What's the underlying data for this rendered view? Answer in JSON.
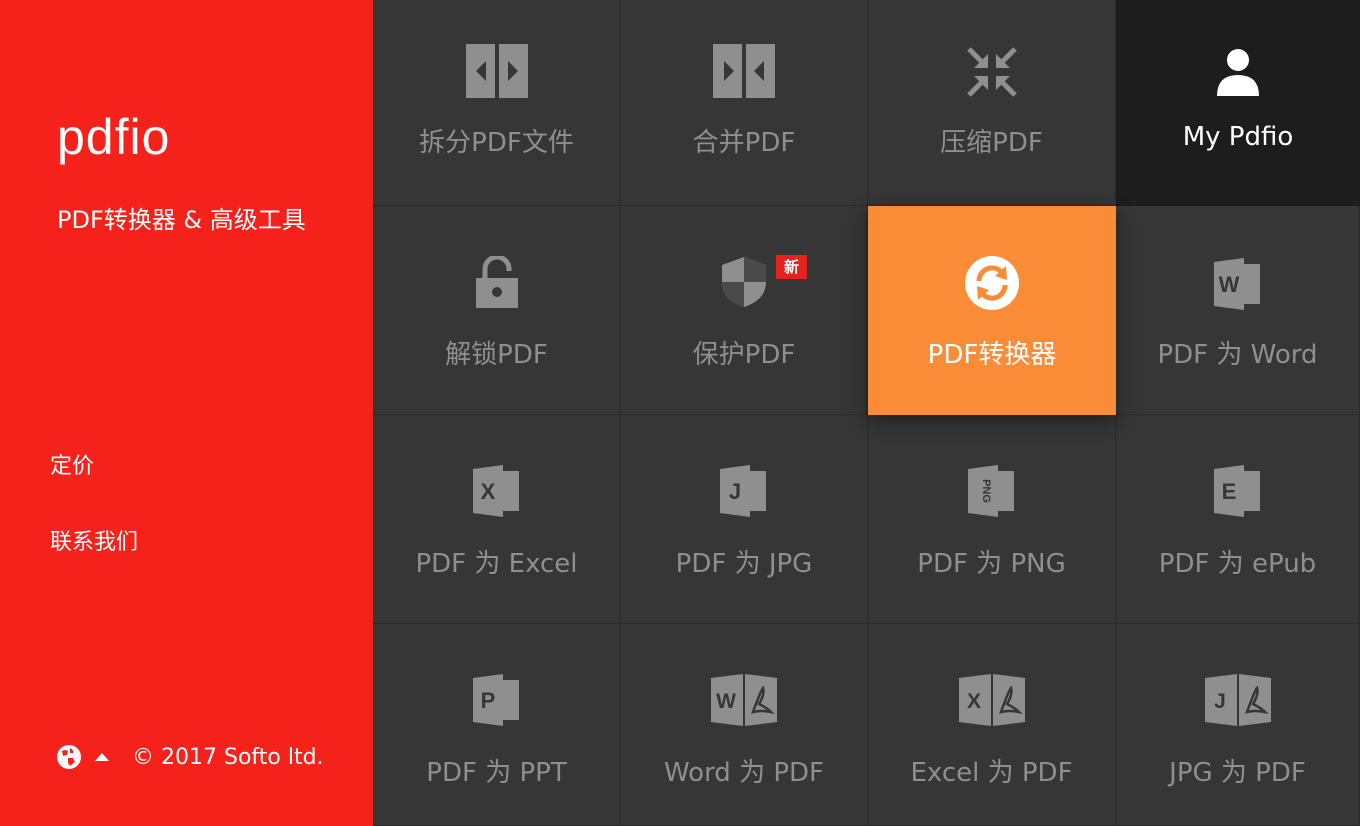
{
  "sidebar": {
    "logo": "pdfio",
    "tagline": "PDF转换器 & 高级工具",
    "nav": [
      {
        "label": "定价"
      },
      {
        "label": "联系我们"
      }
    ],
    "footer": {
      "copyright": "© 2017 Softo ltd."
    }
  },
  "tiles": [
    {
      "label": "拆分PDF文件",
      "icon": "split-icon"
    },
    {
      "label": "合并PDF",
      "icon": "merge-icon"
    },
    {
      "label": "压缩PDF",
      "icon": "compress-icon"
    },
    {
      "label": "My Pdfio",
      "icon": "user-icon"
    },
    {
      "label": "解锁PDF",
      "icon": "unlock-icon"
    },
    {
      "label": "保护PDF",
      "icon": "shield-icon",
      "badge": "新"
    },
    {
      "label": "PDF转换器",
      "icon": "convert-icon"
    },
    {
      "label": "PDF 为 Word",
      "icon": "word-icon"
    },
    {
      "label": "PDF 为 Excel",
      "icon": "excel-icon"
    },
    {
      "label": "PDF 为 JPG",
      "icon": "jpg-icon"
    },
    {
      "label": "PDF 为 PNG",
      "icon": "png-icon"
    },
    {
      "label": "PDF 为 ePub",
      "icon": "epub-icon"
    },
    {
      "label": "PDF 为 PPT",
      "icon": "ppt-icon"
    },
    {
      "label": "Word 为 PDF",
      "icon": "word-to-pdf-icon"
    },
    {
      "label": "Excel 为 PDF",
      "icon": "excel-to-pdf-icon"
    },
    {
      "label": "JPG 为 PDF",
      "icon": "jpg-to-pdf-icon"
    }
  ],
  "colors": {
    "brand_red": "#f5221c",
    "active_orange": "#fa8c38",
    "tile_bg": "#363636",
    "dark_tile": "#1d1d1d",
    "icon_gray": "#8f8f8f"
  }
}
